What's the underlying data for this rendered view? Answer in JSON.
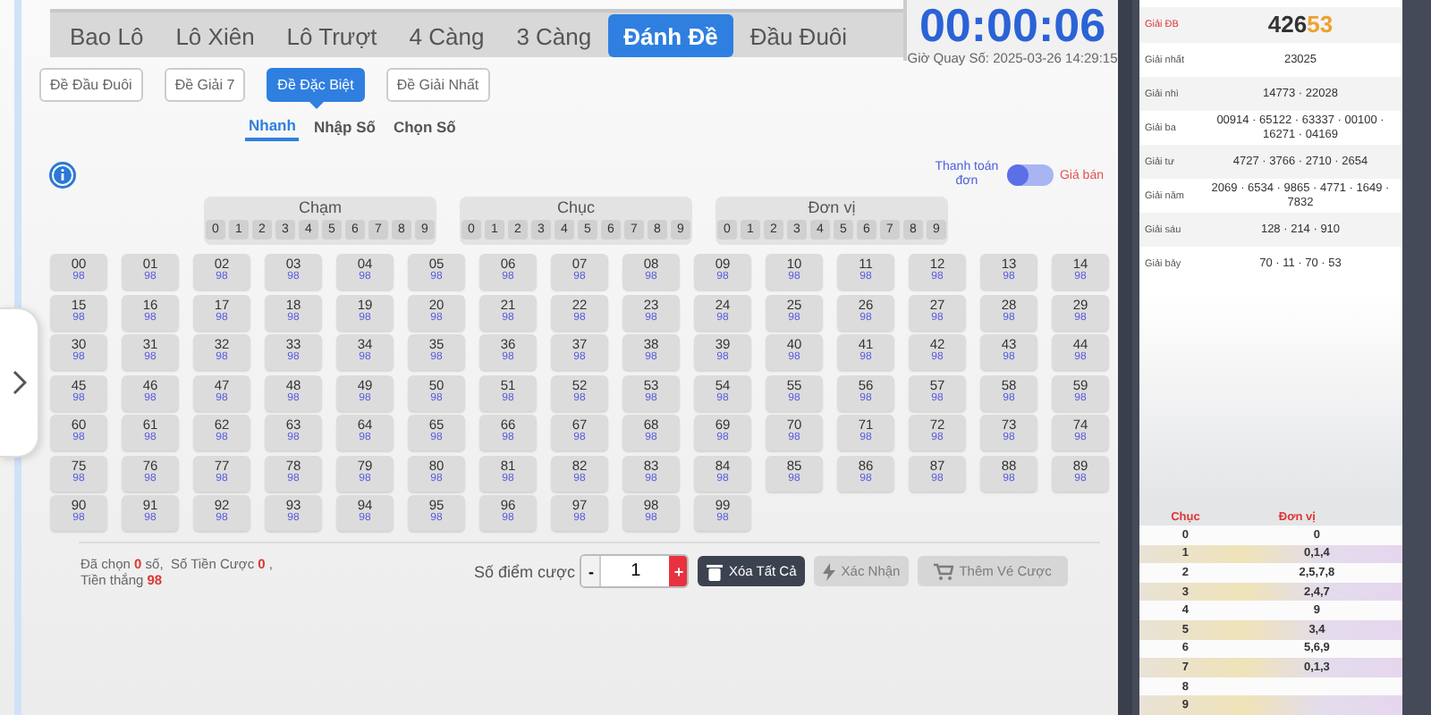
{
  "tabs": [
    {
      "label": "Bao Lô",
      "selected": false
    },
    {
      "label": "Lô Xiên",
      "selected": false
    },
    {
      "label": "Lô Trượt",
      "selected": false
    },
    {
      "label": "4 Càng",
      "selected": false
    },
    {
      "label": "3 Càng",
      "selected": false
    },
    {
      "label": "Đánh Đề",
      "selected": true
    },
    {
      "label": "Đầu Đuôi",
      "selected": false
    }
  ],
  "timer": {
    "countdown": "00:00:06",
    "draw_time": "Giờ Quay Số: 2025-03-26 14:29:15"
  },
  "sub_tabs": [
    {
      "label": "Đề Đầu Đuôi",
      "selected": false
    },
    {
      "label": "Đề Giải 7",
      "selected": false
    },
    {
      "label": "Đề Đặc Biệt",
      "selected": true
    },
    {
      "label": "Đề Giải Nhất",
      "selected": false
    }
  ],
  "modes": [
    {
      "label": "Nhanh",
      "selected": true
    },
    {
      "label": "Nhập Số",
      "selected": false
    },
    {
      "label": "Chọn Số",
      "selected": false
    }
  ],
  "payment_toggle": {
    "left_label": "Thanh toán đơn",
    "right_label": "Giá bán",
    "on": false
  },
  "digit_groups": [
    {
      "title": "Chạm",
      "digits": [
        "0",
        "1",
        "2",
        "3",
        "4",
        "5",
        "6",
        "7",
        "8",
        "9"
      ]
    },
    {
      "title": "Chục",
      "digits": [
        "0",
        "1",
        "2",
        "3",
        "4",
        "5",
        "6",
        "7",
        "8",
        "9"
      ]
    },
    {
      "title": "Đơn vị",
      "digits": [
        "0",
        "1",
        "2",
        "3",
        "4",
        "5",
        "6",
        "7",
        "8",
        "9"
      ]
    }
  ],
  "numbers": [
    {
      "number": "00",
      "odds": "98"
    },
    {
      "number": "01",
      "odds": "98"
    },
    {
      "number": "02",
      "odds": "98"
    },
    {
      "number": "03",
      "odds": "98"
    },
    {
      "number": "04",
      "odds": "98"
    },
    {
      "number": "05",
      "odds": "98"
    },
    {
      "number": "06",
      "odds": "98"
    },
    {
      "number": "07",
      "odds": "98"
    },
    {
      "number": "08",
      "odds": "98"
    },
    {
      "number": "09",
      "odds": "98"
    },
    {
      "number": "10",
      "odds": "98"
    },
    {
      "number": "11",
      "odds": "98"
    },
    {
      "number": "12",
      "odds": "98"
    },
    {
      "number": "13",
      "odds": "98"
    },
    {
      "number": "14",
      "odds": "98"
    },
    {
      "number": "15",
      "odds": "98"
    },
    {
      "number": "16",
      "odds": "98"
    },
    {
      "number": "17",
      "odds": "98"
    },
    {
      "number": "18",
      "odds": "98"
    },
    {
      "number": "19",
      "odds": "98"
    },
    {
      "number": "20",
      "odds": "98"
    },
    {
      "number": "21",
      "odds": "98"
    },
    {
      "number": "22",
      "odds": "98"
    },
    {
      "number": "23",
      "odds": "98"
    },
    {
      "number": "24",
      "odds": "98"
    },
    {
      "number": "25",
      "odds": "98"
    },
    {
      "number": "26",
      "odds": "98"
    },
    {
      "number": "27",
      "odds": "98"
    },
    {
      "number": "28",
      "odds": "98"
    },
    {
      "number": "29",
      "odds": "98"
    },
    {
      "number": "30",
      "odds": "98"
    },
    {
      "number": "31",
      "odds": "98"
    },
    {
      "number": "32",
      "odds": "98"
    },
    {
      "number": "33",
      "odds": "98"
    },
    {
      "number": "34",
      "odds": "98"
    },
    {
      "number": "35",
      "odds": "98"
    },
    {
      "number": "36",
      "odds": "98"
    },
    {
      "number": "37",
      "odds": "98"
    },
    {
      "number": "38",
      "odds": "98"
    },
    {
      "number": "39",
      "odds": "98"
    },
    {
      "number": "40",
      "odds": "98"
    },
    {
      "number": "41",
      "odds": "98"
    },
    {
      "number": "42",
      "odds": "98"
    },
    {
      "number": "43",
      "odds": "98"
    },
    {
      "number": "44",
      "odds": "98"
    },
    {
      "number": "45",
      "odds": "98"
    },
    {
      "number": "46",
      "odds": "98"
    },
    {
      "number": "47",
      "odds": "98"
    },
    {
      "number": "48",
      "odds": "98"
    },
    {
      "number": "49",
      "odds": "98"
    },
    {
      "number": "50",
      "odds": "98"
    },
    {
      "number": "51",
      "odds": "98"
    },
    {
      "number": "52",
      "odds": "98"
    },
    {
      "number": "53",
      "odds": "98"
    },
    {
      "number": "54",
      "odds": "98"
    },
    {
      "number": "55",
      "odds": "98"
    },
    {
      "number": "56",
      "odds": "98"
    },
    {
      "number": "57",
      "odds": "98"
    },
    {
      "number": "58",
      "odds": "98"
    },
    {
      "number": "59",
      "odds": "98"
    },
    {
      "number": "60",
      "odds": "98"
    },
    {
      "number": "61",
      "odds": "98"
    },
    {
      "number": "62",
      "odds": "98"
    },
    {
      "number": "63",
      "odds": "98"
    },
    {
      "number": "64",
      "odds": "98"
    },
    {
      "number": "65",
      "odds": "98"
    },
    {
      "number": "66",
      "odds": "98"
    },
    {
      "number": "67",
      "odds": "98"
    },
    {
      "number": "68",
      "odds": "98"
    },
    {
      "number": "69",
      "odds": "98"
    },
    {
      "number": "70",
      "odds": "98"
    },
    {
      "number": "71",
      "odds": "98"
    },
    {
      "number": "72",
      "odds": "98"
    },
    {
      "number": "73",
      "odds": "98"
    },
    {
      "number": "74",
      "odds": "98"
    },
    {
      "number": "75",
      "odds": "98"
    },
    {
      "number": "76",
      "odds": "98"
    },
    {
      "number": "77",
      "odds": "98"
    },
    {
      "number": "78",
      "odds": "98"
    },
    {
      "number": "79",
      "odds": "98"
    },
    {
      "number": "80",
      "odds": "98"
    },
    {
      "number": "81",
      "odds": "98"
    },
    {
      "number": "82",
      "odds": "98"
    },
    {
      "number": "83",
      "odds": "98"
    },
    {
      "number": "84",
      "odds": "98"
    },
    {
      "number": "85",
      "odds": "98"
    },
    {
      "number": "86",
      "odds": "98"
    },
    {
      "number": "87",
      "odds": "98"
    },
    {
      "number": "88",
      "odds": "98"
    },
    {
      "number": "89",
      "odds": "98"
    },
    {
      "number": "90",
      "odds": "98"
    },
    {
      "number": "91",
      "odds": "98"
    },
    {
      "number": "92",
      "odds": "98"
    },
    {
      "number": "93",
      "odds": "98"
    },
    {
      "number": "94",
      "odds": "98"
    },
    {
      "number": "95",
      "odds": "98"
    },
    {
      "number": "96",
      "odds": "98"
    },
    {
      "number": "97",
      "odds": "98"
    },
    {
      "number": "98",
      "odds": "98"
    },
    {
      "number": "99",
      "odds": "98"
    }
  ],
  "summary": {
    "chosen_label": "Đã chọn",
    "chosen": "0",
    "chosen_unit": "số,",
    "stake_label": "Số Tiền Cược",
    "stake": "0",
    "stake_sep": ",",
    "win_label": "Tiền thắng",
    "win": "98"
  },
  "bet": {
    "label": "Số điểm cược",
    "minus": "-",
    "value": "1",
    "plus": "+"
  },
  "actions": [
    {
      "label": "Xóa Tất Cả",
      "kind": "trash",
      "disabled": false
    },
    {
      "label": "Xác Nhận",
      "kind": "bolt",
      "disabled": true
    },
    {
      "label": "Thêm Vé Cược",
      "kind": "cart",
      "disabled": true
    }
  ],
  "results": [
    {
      "label": "Giải ĐB",
      "value": "426",
      "value_highlight": "53"
    },
    {
      "label": "Giải nhất",
      "value": "23025"
    },
    {
      "label": "Giải nhì",
      "value": "14773 · 22028"
    },
    {
      "label": "Giải ba",
      "value": "00914 · 65122 · 63337 · 00100 · 16271 · 04169"
    },
    {
      "label": "Giải tư",
      "value": "4727 · 3766 · 2710 · 2654"
    },
    {
      "label": "Giải năm",
      "value": "2069 · 6534 · 9865 · 4771 · 1649 · 7832"
    },
    {
      "label": "Giải sáu",
      "value": "128 · 214 · 910"
    },
    {
      "label": "Giải bảy",
      "value": "70 · 11 · 70 · 53"
    }
  ],
  "head_tail": {
    "columns": [
      "Chục",
      "Đơn vị"
    ],
    "rows": [
      {
        "tens": "0",
        "units": "0"
      },
      {
        "tens": "1",
        "units": "0,1,4"
      },
      {
        "tens": "2",
        "units": "2,5,7,8"
      },
      {
        "tens": "3",
        "units": "2,4,7"
      },
      {
        "tens": "4",
        "units": "9"
      },
      {
        "tens": "5",
        "units": "3,4"
      },
      {
        "tens": "6",
        "units": "5,6,9"
      },
      {
        "tens": "7",
        "units": "0,1,3"
      },
      {
        "tens": "8"
      },
      {
        "tens": "9"
      }
    ]
  }
}
